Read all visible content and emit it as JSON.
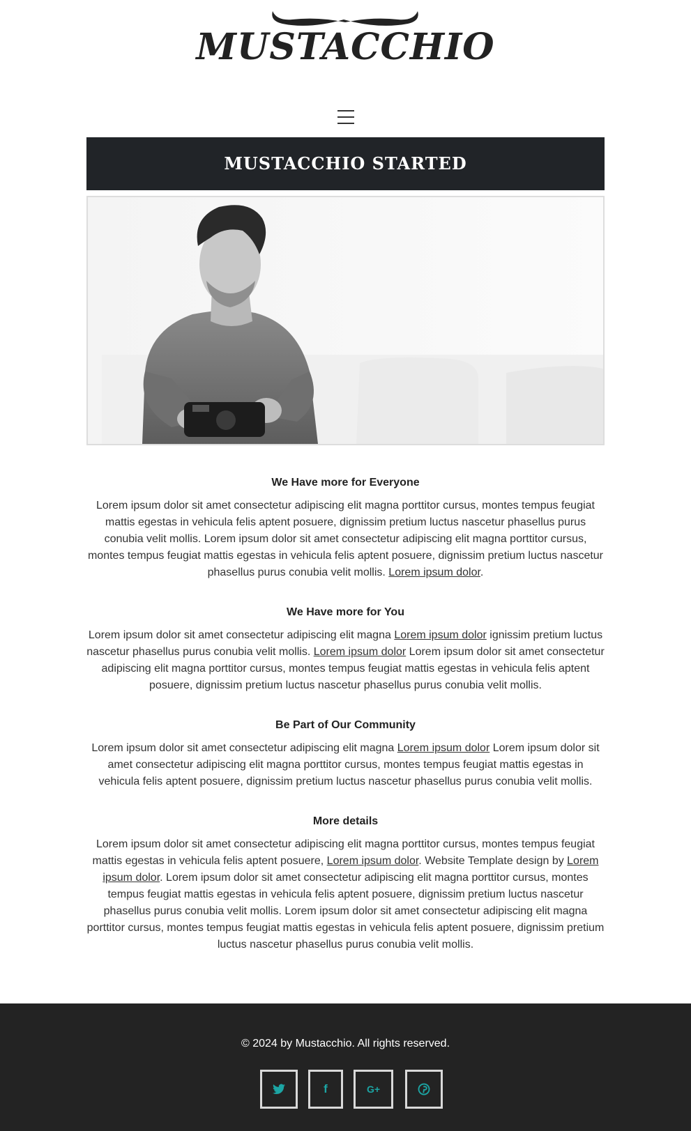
{
  "brand": {
    "name": "MUSTACCHIO"
  },
  "nav": {
    "menu_icon": "hamburger-menu-icon"
  },
  "page": {
    "title": "MUSTACCHIO STARTED"
  },
  "hero": {
    "alt": "Man holding a camera"
  },
  "sections": [
    {
      "heading": "We Have more for Everyone",
      "parts": [
        "Lorem ipsum dolor sit amet consectetur adipiscing elit magna porttitor cursus, montes tempus feugiat mattis egestas in vehicula felis aptent posuere, dignissim pretium luctus nascetur phasellus purus conubia velit mollis. Lorem ipsum dolor sit amet consectetur adipiscing elit magna porttitor cursus, montes tempus feugiat mattis egestas in vehicula felis aptent posuere, dignissim pretium luctus nascetur phasellus purus conubia velit mollis. ",
        "Lorem ipsum dolor",
        "."
      ]
    },
    {
      "heading": "We Have more for You",
      "parts": [
        "Lorem ipsum dolor sit amet consectetur adipiscing elit magna ",
        "Lorem ipsum dolor",
        " ignissim pretium luctus nascetur phasellus purus conubia velit mollis. ",
        "Lorem ipsum dolor",
        " Lorem ipsum dolor sit amet consectetur adipiscing elit magna porttitor cursus, montes tempus feugiat mattis egestas in vehicula felis aptent posuere, dignissim pretium luctus nascetur phasellus purus conubia velit mollis."
      ]
    },
    {
      "heading": "Be Part of Our Community",
      "parts": [
        "Lorem ipsum dolor sit amet consectetur adipiscing elit magna ",
        "Lorem ipsum dolor",
        " Lorem ipsum dolor sit amet consectetur adipiscing elit magna porttitor cursus, montes tempus feugiat mattis egestas in vehicula felis aptent posuere, dignissim pretium luctus nascetur phasellus purus conubia velit mollis."
      ]
    },
    {
      "heading": "More details",
      "parts": [
        "Lorem ipsum dolor sit amet consectetur adipiscing elit magna porttitor cursus, montes tempus feugiat mattis egestas in vehicula felis aptent posuere, ",
        "Lorem ipsum dolor",
        ". Website Template design by ",
        "Lorem ipsum dolor",
        ". Lorem ipsum dolor sit amet consectetur adipiscing elit magna porttitor cursus, montes tempus feugiat mattis egestas in vehicula felis aptent posuere, dignissim pretium luctus nascetur phasellus purus conubia velit mollis. Lorem ipsum dolor sit amet consectetur adipiscing elit magna porttitor cursus, montes tempus feugiat mattis egestas in vehicula felis aptent posuere, dignissim pretium luctus nascetur phasellus purus conubia velit mollis."
      ]
    }
  ],
  "footer": {
    "copyright": "© 2024 by Mustacchio. All rights reserved.",
    "social": [
      {
        "name": "twitter",
        "icon": "twitter-icon",
        "glyph": "🐦︎"
      },
      {
        "name": "facebook",
        "icon": "facebook-icon",
        "glyph": "f"
      },
      {
        "name": "google-plus",
        "icon": "google-plus-icon",
        "glyph": "G+"
      },
      {
        "name": "pinterest",
        "icon": "pinterest-icon",
        "glyph": "℗"
      }
    ]
  },
  "colors": {
    "title_bar": "#212428",
    "footer": "#232323",
    "social_accent": "#1ca5a4"
  }
}
